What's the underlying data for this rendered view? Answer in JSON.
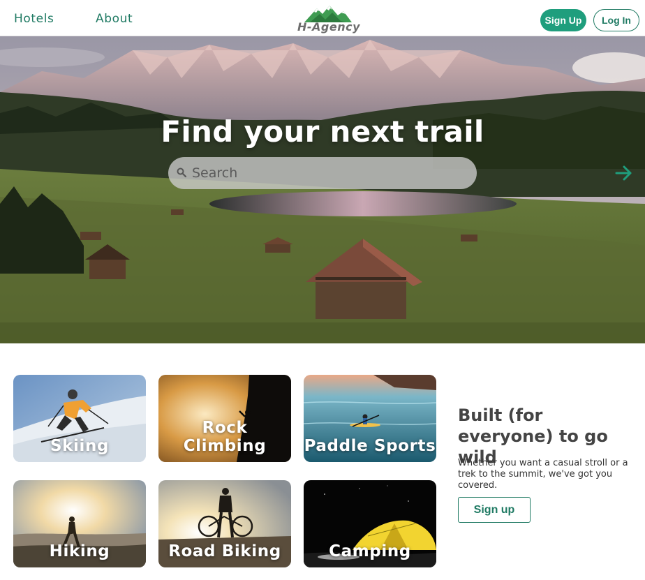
{
  "nav": {
    "links": [
      {
        "label": "Hotels"
      },
      {
        "label": "About"
      }
    ],
    "logo_text": "H-Agency",
    "signup_label": "Sign Up",
    "login_label": "Log In"
  },
  "hero": {
    "title": "Find your next trail",
    "search_placeholder": "Search"
  },
  "activities": [
    {
      "label": "Skiing",
      "icon": "skier"
    },
    {
      "label": "Rock Climbing",
      "icon": "climber"
    },
    {
      "label": "Paddle Sports",
      "icon": "kayak"
    },
    {
      "label": "Hiking",
      "icon": "hiker"
    },
    {
      "label": "Road Biking",
      "icon": "bicycle"
    },
    {
      "label": "Camping",
      "icon": "tent"
    }
  ],
  "promo": {
    "title": "Built (for everyone) to go wild",
    "text": "Whether you want a casual stroll or a trek to the summit, we've got you covered.",
    "button_label": "Sign up"
  },
  "colors": {
    "accent": "#1f9e7d",
    "accent_dark": "#1f7a63",
    "text_dark": "#444444"
  }
}
